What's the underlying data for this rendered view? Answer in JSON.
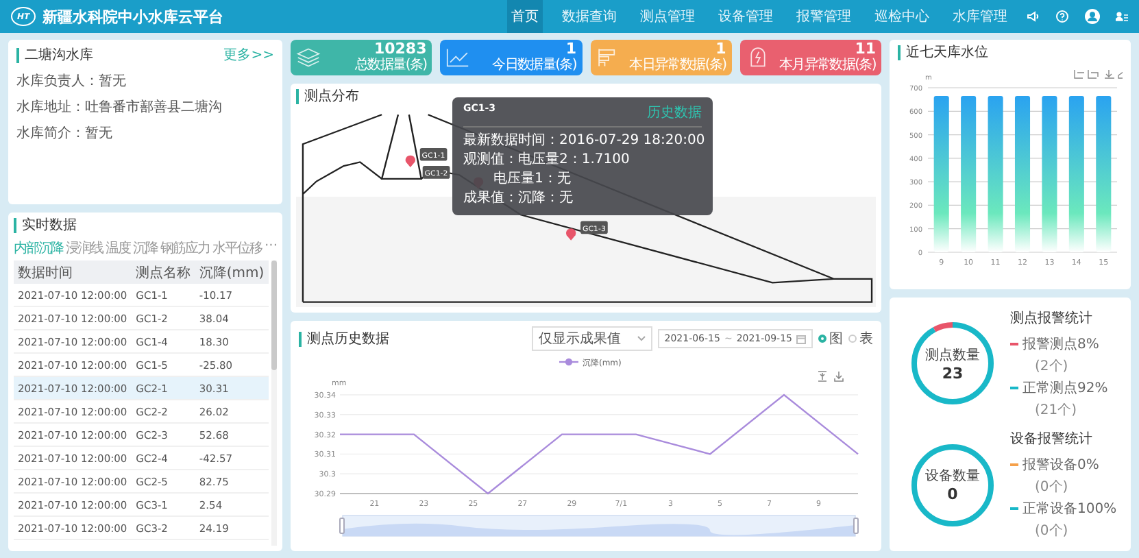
{
  "header": {
    "logo": "HT",
    "title": "新疆水科院中小水库云平台",
    "nav": [
      {
        "label": "首页",
        "selected": true
      },
      {
        "label": "数据查询",
        "selected": false
      },
      {
        "label": "测点管理",
        "selected": false
      },
      {
        "label": "设备管理",
        "selected": false
      },
      {
        "label": "报警管理",
        "selected": false
      },
      {
        "label": "巡检中心",
        "selected": false
      },
      {
        "label": "水库管理",
        "selected": false
      }
    ]
  },
  "reservoir": {
    "name": "二塘沟水库",
    "more": "更多>>",
    "fields": [
      {
        "label": "水库负责人：",
        "value": "暂无"
      },
      {
        "label": "水库地址：",
        "value": "吐鲁番市鄯善县二塘沟"
      },
      {
        "label": "水库简介：",
        "value": "暂无"
      }
    ]
  },
  "realtime": {
    "title": "实时数据",
    "tabs": [
      {
        "label": "内部沉降",
        "selected": true
      },
      {
        "label": "浸润线",
        "selected": false
      },
      {
        "label": "温度",
        "selected": false
      },
      {
        "label": "沉降",
        "selected": false
      },
      {
        "label": "钢筋应力",
        "selected": false
      },
      {
        "label": "水平位移",
        "selected": false
      }
    ],
    "more": "···",
    "columns": [
      "数据时间",
      "测点名称",
      "沉降(mm)"
    ],
    "rows": [
      {
        "time": "2021-07-10 12:00:00",
        "point": "GC1-1",
        "value": "-10.17",
        "selected": false
      },
      {
        "time": "2021-07-10 12:00:00",
        "point": "GC1-2",
        "value": "38.04",
        "selected": false
      },
      {
        "time": "2021-07-10 12:00:00",
        "point": "GC1-4",
        "value": "18.30",
        "selected": false
      },
      {
        "time": "2021-07-10 12:00:00",
        "point": "GC1-5",
        "value": "-25.80",
        "selected": false
      },
      {
        "time": "2021-07-10 12:00:00",
        "point": "GC2-1",
        "value": "30.31",
        "selected": true
      },
      {
        "time": "2021-07-10 12:00:00",
        "point": "GC2-2",
        "value": "26.02",
        "selected": false
      },
      {
        "time": "2021-07-10 12:00:00",
        "point": "GC2-3",
        "value": "52.68",
        "selected": false
      },
      {
        "time": "2021-07-10 12:00:00",
        "point": "GC2-4",
        "value": "-42.57",
        "selected": false
      },
      {
        "time": "2021-07-10 12:00:00",
        "point": "GC2-5",
        "value": "82.75",
        "selected": false
      },
      {
        "time": "2021-07-10 12:00:00",
        "point": "GC3-1",
        "value": "2.54",
        "selected": false
      },
      {
        "time": "2021-07-10 12:00:00",
        "point": "GC3-2",
        "value": "24.19",
        "selected": false
      }
    ]
  },
  "stats": [
    {
      "kind": "total",
      "value": "10283",
      "label": "总数据量(条)"
    },
    {
      "kind": "today",
      "value": "1",
      "label": "今日数据量(条)"
    },
    {
      "kind": "day_alarm",
      "value": "1",
      "label": "本日异常数据(条)"
    },
    {
      "kind": "month_alarm",
      "value": "11",
      "label": "本月异常数据(条)"
    }
  ],
  "distribution": {
    "title": "测点分布",
    "markers": [
      {
        "label": "GC1-1"
      },
      {
        "label": "GC1-2"
      },
      {
        "label": "GC1-3"
      }
    ],
    "tooltip": {
      "title": "GC1-3",
      "link": "历史数据",
      "lines": [
        "最新数据时间：2016-07-29 18:20:00",
        "观测值：电压量2：1.7100",
        "电压量1：无",
        "成果值：沉降：无"
      ]
    }
  },
  "history": {
    "title": "测点历史数据",
    "filter": "仅显示成果值",
    "date_from": "2021-06-15",
    "date_separator": "~",
    "date_to": "2021-09-15",
    "views": [
      {
        "label": "图",
        "selected": true
      },
      {
        "label": "表",
        "selected": false
      }
    ],
    "chart_data": {
      "type": "line",
      "ylabel": "mm",
      "grid": true,
      "x": [
        "2021-06-19 14:24",
        "2021-06-22 14:24",
        "2021-06-25 14:24",
        "2021-06-28 14:24",
        "2021-07-01 14:24",
        "2021-07-04 14:24",
        "2021-07-07 14:24",
        "2021-07-10 14:24"
      ],
      "xlim": [
        "2021-06-19 14:24",
        "2021-07-10 14:24"
      ],
      "ylim": [
        30.29,
        30.34
      ],
      "xticks": [
        {
          "value": "2021-06-21 00:00",
          "label": "21"
        },
        {
          "value": "2021-06-23 00:00",
          "label": "23"
        },
        {
          "value": "2021-06-25 00:00",
          "label": "25"
        },
        {
          "value": "2021-06-27 00:00",
          "label": "27"
        },
        {
          "value": "2021-06-29 00:00",
          "label": "29"
        },
        {
          "value": "2021-07-01 00:00",
          "label": "7/1"
        },
        {
          "value": "2021-07-03 00:00",
          "label": "3"
        },
        {
          "value": "2021-07-05 00:00",
          "label": "5"
        },
        {
          "value": "2021-07-07 00:00",
          "label": "7"
        },
        {
          "value": "2021-07-09 00:00",
          "label": "9"
        }
      ],
      "yticks": [
        30.29,
        {
          "value": 30.3,
          "label": "30.3"
        },
        30.31,
        30.32,
        30.33,
        30.34
      ],
      "series": [
        {
          "name": "沉降(mm)",
          "color": "#a98bdc",
          "values": [
            30.32,
            30.32,
            30.29,
            30.32,
            30.32,
            30.31,
            30.34,
            30.31
          ]
        }
      ]
    }
  },
  "water_level": {
    "title": "近七天库水位",
    "chart_data": {
      "type": "bar",
      "ylabel": "m",
      "grid": true,
      "categories": [
        "9",
        "10",
        "11",
        "12",
        "13",
        "14",
        "15"
      ],
      "values": [
        665,
        665,
        665,
        665,
        665,
        665,
        665
      ],
      "ylim": [
        0,
        700
      ],
      "yticks": [
        0,
        100,
        200,
        300,
        400,
        500,
        600,
        700
      ]
    }
  },
  "alarm_stats": [
    {
      "center_label": "测点数量",
      "count": "23",
      "title": "测点报警统计",
      "items": [
        {
          "label": "报警测点8%",
          "count": "(2个)",
          "color": "#e8556a",
          "level": 0.08
        },
        {
          "label": "正常测点92%",
          "count": "(21个)",
          "color": "#19b8c8",
          "level": 0.92
        }
      ]
    },
    {
      "center_label": "设备数量",
      "count": "0",
      "title": "设备报警统计",
      "items": [
        {
          "label": "报警设备0%",
          "count": "(0个)",
          "color": "#f5a04a",
          "level": 0
        },
        {
          "label": "正常设备100%",
          "count": "(0个)",
          "color": "#19b8c8",
          "level": 1
        }
      ]
    }
  ]
}
